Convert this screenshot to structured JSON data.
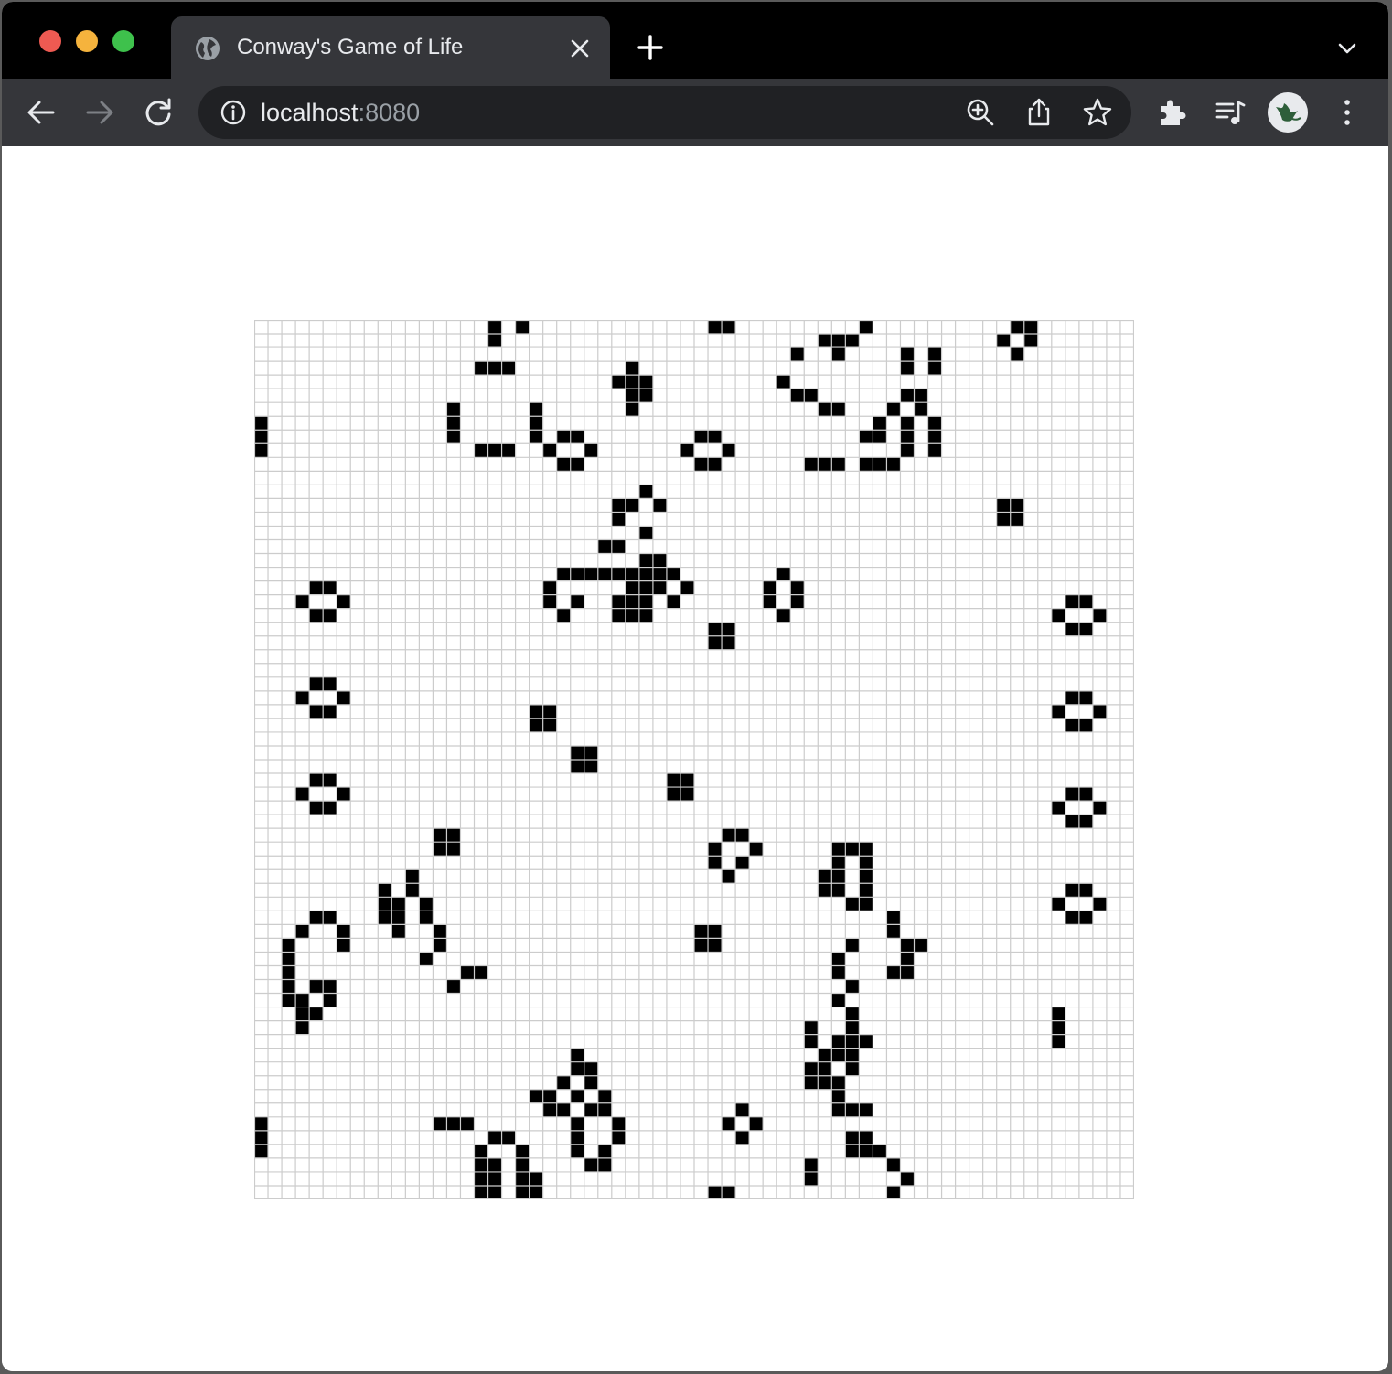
{
  "browser": {
    "tab_title": "Conway's Game of Life",
    "url_host": "localhost",
    "url_port": ":8080"
  },
  "game": {
    "rows": 64,
    "cols": 64,
    "colors": {
      "alive": "#000000",
      "dead": "#ffffff",
      "grid": "#cccccc"
    },
    "live_cells": [
      [
        0,
        17
      ],
      [
        0,
        19
      ],
      [
        1,
        17
      ],
      [
        3,
        16
      ],
      [
        3,
        17
      ],
      [
        3,
        18
      ],
      [
        6,
        14
      ],
      [
        7,
        14
      ],
      [
        8,
        14
      ],
      [
        6,
        20
      ],
      [
        7,
        20
      ],
      [
        8,
        20
      ],
      [
        9,
        16
      ],
      [
        9,
        17
      ],
      [
        9,
        18
      ],
      [
        0,
        33
      ],
      [
        0,
        34
      ],
      [
        3,
        27
      ],
      [
        4,
        27
      ],
      [
        5,
        27
      ],
      [
        4,
        26
      ],
      [
        4,
        28
      ],
      [
        5,
        28
      ],
      [
        6,
        27
      ],
      [
        8,
        22
      ],
      [
        8,
        23
      ],
      [
        9,
        21
      ],
      [
        9,
        24
      ],
      [
        10,
        22
      ],
      [
        10,
        23
      ],
      [
        8,
        32
      ],
      [
        8,
        33
      ],
      [
        9,
        31
      ],
      [
        9,
        34
      ],
      [
        10,
        32
      ],
      [
        10,
        33
      ],
      [
        7,
        0
      ],
      [
        8,
        0
      ],
      [
        9,
        0
      ],
      [
        0,
        44
      ],
      [
        1,
        41
      ],
      [
        1,
        42
      ],
      [
        1,
        43
      ],
      [
        2,
        39
      ],
      [
        2,
        42
      ],
      [
        4,
        38
      ],
      [
        5,
        39
      ],
      [
        5,
        40
      ],
      [
        6,
        41
      ],
      [
        6,
        42
      ],
      [
        2,
        47
      ],
      [
        3,
        47
      ],
      [
        2,
        49
      ],
      [
        3,
        49
      ],
      [
        5,
        47
      ],
      [
        5,
        48
      ],
      [
        6,
        46
      ],
      [
        6,
        48
      ],
      [
        7,
        45
      ],
      [
        7,
        47
      ],
      [
        8,
        44
      ],
      [
        8,
        45
      ],
      [
        8,
        47
      ],
      [
        9,
        47
      ],
      [
        7,
        49
      ],
      [
        8,
        49
      ],
      [
        9,
        49
      ],
      [
        10,
        40
      ],
      [
        10,
        41
      ],
      [
        10,
        42
      ],
      [
        10,
        44
      ],
      [
        10,
        45
      ],
      [
        10,
        46
      ],
      [
        0,
        55
      ],
      [
        0,
        56
      ],
      [
        1,
        54
      ],
      [
        1,
        56
      ],
      [
        2,
        55
      ],
      [
        13,
        54
      ],
      [
        13,
        55
      ],
      [
        14,
        54
      ],
      [
        14,
        55
      ],
      [
        12,
        28
      ],
      [
        13,
        26
      ],
      [
        13,
        27
      ],
      [
        13,
        29
      ],
      [
        14,
        26
      ],
      [
        15,
        28
      ],
      [
        16,
        25
      ],
      [
        16,
        26
      ],
      [
        17,
        28
      ],
      [
        17,
        29
      ],
      [
        18,
        22
      ],
      [
        18,
        23
      ],
      [
        18,
        24
      ],
      [
        18,
        25
      ],
      [
        18,
        26
      ],
      [
        18,
        27
      ],
      [
        18,
        28
      ],
      [
        18,
        29
      ],
      [
        18,
        30
      ],
      [
        19,
        21
      ],
      [
        19,
        27
      ],
      [
        19,
        28
      ],
      [
        19,
        29
      ],
      [
        19,
        31
      ],
      [
        20,
        21
      ],
      [
        20,
        23
      ],
      [
        20,
        26
      ],
      [
        20,
        27
      ],
      [
        20,
        28
      ],
      [
        20,
        30
      ],
      [
        21,
        22
      ],
      [
        21,
        26
      ],
      [
        21,
        27
      ],
      [
        21,
        28
      ],
      [
        18,
        38
      ],
      [
        19,
        37
      ],
      [
        19,
        39
      ],
      [
        20,
        37
      ],
      [
        20,
        39
      ],
      [
        21,
        38
      ],
      [
        19,
        4
      ],
      [
        19,
        5
      ],
      [
        20,
        3
      ],
      [
        20,
        6
      ],
      [
        21,
        4
      ],
      [
        21,
        5
      ],
      [
        20,
        59
      ],
      [
        20,
        60
      ],
      [
        21,
        58
      ],
      [
        21,
        61
      ],
      [
        22,
        59
      ],
      [
        22,
        60
      ],
      [
        22,
        33
      ],
      [
        22,
        34
      ],
      [
        23,
        33
      ],
      [
        23,
        34
      ],
      [
        26,
        4
      ],
      [
        26,
        5
      ],
      [
        27,
        3
      ],
      [
        27,
        6
      ],
      [
        28,
        4
      ],
      [
        28,
        5
      ],
      [
        27,
        59
      ],
      [
        27,
        60
      ],
      [
        28,
        58
      ],
      [
        28,
        61
      ],
      [
        29,
        59
      ],
      [
        29,
        60
      ],
      [
        28,
        20
      ],
      [
        28,
        21
      ],
      [
        29,
        20
      ],
      [
        29,
        21
      ],
      [
        31,
        23
      ],
      [
        31,
        24
      ],
      [
        32,
        23
      ],
      [
        32,
        24
      ],
      [
        33,
        30
      ],
      [
        33,
        31
      ],
      [
        34,
        30
      ],
      [
        34,
        31
      ],
      [
        33,
        4
      ],
      [
        33,
        5
      ],
      [
        34,
        3
      ],
      [
        34,
        6
      ],
      [
        35,
        4
      ],
      [
        35,
        5
      ],
      [
        34,
        59
      ],
      [
        34,
        60
      ],
      [
        35,
        58
      ],
      [
        35,
        61
      ],
      [
        36,
        59
      ],
      [
        36,
        60
      ],
      [
        37,
        13
      ],
      [
        37,
        14
      ],
      [
        38,
        13
      ],
      [
        38,
        14
      ],
      [
        37,
        34
      ],
      [
        37,
        35
      ],
      [
        38,
        33
      ],
      [
        38,
        36
      ],
      [
        39,
        33
      ],
      [
        39,
        35
      ],
      [
        40,
        34
      ],
      [
        38,
        42
      ],
      [
        38,
        43
      ],
      [
        38,
        44
      ],
      [
        39,
        42
      ],
      [
        39,
        44
      ],
      [
        40,
        41
      ],
      [
        40,
        42
      ],
      [
        40,
        44
      ],
      [
        41,
        41
      ],
      [
        41,
        42
      ],
      [
        41,
        44
      ],
      [
        42,
        43
      ],
      [
        42,
        44
      ],
      [
        43,
        46
      ],
      [
        44,
        46
      ],
      [
        45,
        43
      ],
      [
        45,
        47
      ],
      [
        45,
        48
      ],
      [
        46,
        42
      ],
      [
        46,
        47
      ],
      [
        47,
        42
      ],
      [
        47,
        46
      ],
      [
        47,
        47
      ],
      [
        48,
        43
      ],
      [
        49,
        42
      ],
      [
        50,
        43
      ],
      [
        51,
        40
      ],
      [
        51,
        43
      ],
      [
        52,
        40
      ],
      [
        52,
        44
      ],
      [
        41,
        9
      ],
      [
        42,
        9
      ],
      [
        42,
        10
      ],
      [
        43,
        9
      ],
      [
        43,
        10
      ],
      [
        41,
        11
      ],
      [
        40,
        11
      ],
      [
        42,
        12
      ],
      [
        43,
        12
      ],
      [
        44,
        13
      ],
      [
        45,
        13
      ],
      [
        46,
        12
      ],
      [
        44,
        10
      ],
      [
        47,
        15
      ],
      [
        47,
        16
      ],
      [
        48,
        14
      ],
      [
        41,
        59
      ],
      [
        41,
        60
      ],
      [
        42,
        58
      ],
      [
        42,
        61
      ],
      [
        43,
        59
      ],
      [
        43,
        60
      ],
      [
        43,
        4
      ],
      [
        43,
        5
      ],
      [
        44,
        3
      ],
      [
        44,
        6
      ],
      [
        45,
        2
      ],
      [
        45,
        6
      ],
      [
        46,
        2
      ],
      [
        47,
        2
      ],
      [
        48,
        2
      ],
      [
        49,
        2
      ],
      [
        48,
        4
      ],
      [
        48,
        5
      ],
      [
        49,
        3
      ],
      [
        49,
        5
      ],
      [
        50,
        3
      ],
      [
        50,
        4
      ],
      [
        51,
        3
      ],
      [
        44,
        32
      ],
      [
        44,
        33
      ],
      [
        45,
        32
      ],
      [
        45,
        33
      ],
      [
        50,
        58
      ],
      [
        51,
        58
      ],
      [
        52,
        58
      ],
      [
        52,
        43
      ],
      [
        53,
        41
      ],
      [
        53,
        43
      ],
      [
        54,
        40
      ],
      [
        54,
        41
      ],
      [
        54,
        43
      ],
      [
        55,
        40
      ],
      [
        55,
        41
      ],
      [
        55,
        42
      ],
      [
        53,
        42
      ],
      [
        52,
        42
      ],
      [
        53,
        23
      ],
      [
        54,
        23
      ],
      [
        54,
        24
      ],
      [
        55,
        22
      ],
      [
        55,
        24
      ],
      [
        56,
        20
      ],
      [
        56,
        21
      ],
      [
        56,
        23
      ],
      [
        56,
        25
      ],
      [
        57,
        21
      ],
      [
        57,
        22
      ],
      [
        57,
        24
      ],
      [
        57,
        25
      ],
      [
        58,
        23
      ],
      [
        58,
        26
      ],
      [
        59,
        23
      ],
      [
        59,
        26
      ],
      [
        60,
        23
      ],
      [
        60,
        25
      ],
      [
        61,
        24
      ],
      [
        61,
        25
      ],
      [
        58,
        13
      ],
      [
        58,
        14
      ],
      [
        58,
        15
      ],
      [
        59,
        17
      ],
      [
        59,
        18
      ],
      [
        60,
        16
      ],
      [
        60,
        19
      ],
      [
        61,
        16
      ],
      [
        61,
        17
      ],
      [
        61,
        19
      ],
      [
        62,
        16
      ],
      [
        62,
        17
      ],
      [
        62,
        19
      ],
      [
        62,
        20
      ],
      [
        63,
        16
      ],
      [
        63,
        17
      ],
      [
        63,
        19
      ],
      [
        63,
        20
      ],
      [
        58,
        0
      ],
      [
        59,
        0
      ],
      [
        60,
        0
      ],
      [
        57,
        35
      ],
      [
        58,
        34
      ],
      [
        58,
        36
      ],
      [
        59,
        35
      ],
      [
        56,
        42
      ],
      [
        57,
        42
      ],
      [
        57,
        43
      ],
      [
        57,
        44
      ],
      [
        59,
        43
      ],
      [
        59,
        44
      ],
      [
        60,
        43
      ],
      [
        60,
        44
      ],
      [
        60,
        45
      ],
      [
        61,
        46
      ],
      [
        62,
        47
      ],
      [
        63,
        46
      ],
      [
        61,
        40
      ],
      [
        62,
        40
      ],
      [
        63,
        33
      ],
      [
        63,
        34
      ]
    ]
  }
}
